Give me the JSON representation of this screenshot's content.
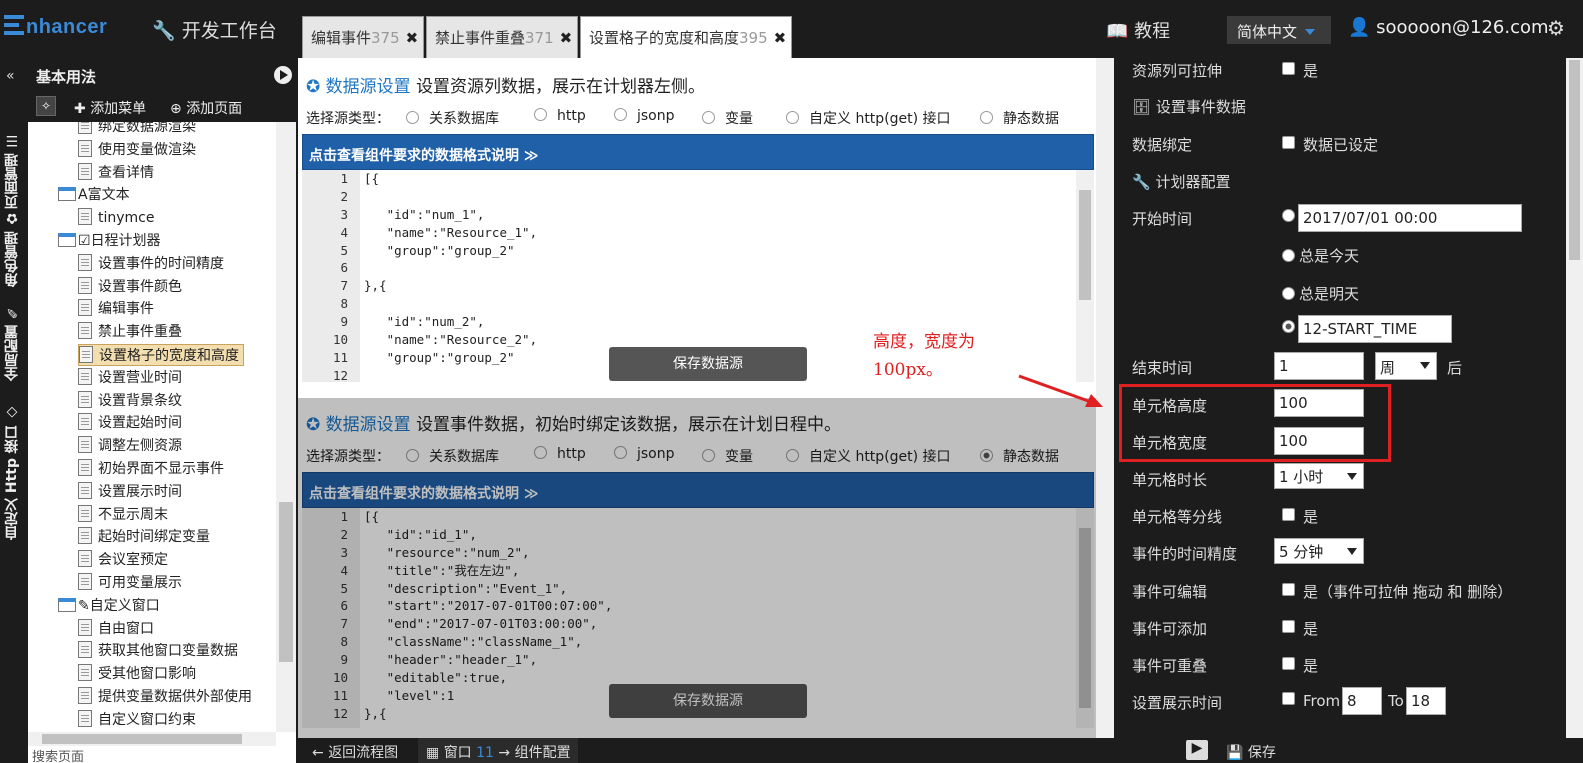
{
  "header": {
    "logo": "nhancer",
    "devbench": "开发工作台",
    "tabs": [
      {
        "label": "编辑事件",
        "count": "375"
      },
      {
        "label": "禁止事件重叠",
        "count": "371"
      },
      {
        "label": "设置格子的宽度和高度",
        "count": "395"
      }
    ],
    "tab_close": "✖",
    "tutorial": "教程",
    "language": "简体中文",
    "user": "sooooon@126.com"
  },
  "vtabs": [
    "页面管理",
    "角色管理",
    "全局配置",
    "自定义 Http 接口"
  ],
  "sidebar": {
    "title": "基本用法",
    "add_menu": "添加菜单",
    "add_page": "添加页面",
    "search": "搜索页面",
    "tree": [
      {
        "label": "绑定数据源渲染",
        "type": "doc",
        "level": 2
      },
      {
        "label": "使用变量做渲染",
        "type": "doc",
        "level": 2
      },
      {
        "label": "查看详情",
        "type": "doc",
        "level": 2
      },
      {
        "label": "富文本",
        "type": "folder",
        "level": 1,
        "prefix": "A"
      },
      {
        "label": "tinymce",
        "type": "doc",
        "level": 2
      },
      {
        "label": "日程计划器",
        "type": "folder",
        "level": 1,
        "prefix": "☑"
      },
      {
        "label": "设置事件的时间精度",
        "type": "doc",
        "level": 2
      },
      {
        "label": "设置事件颜色",
        "type": "doc",
        "level": 2
      },
      {
        "label": "编辑事件",
        "type": "doc",
        "level": 2
      },
      {
        "label": "禁止事件重叠",
        "type": "doc",
        "level": 2
      },
      {
        "label": "设置格子的宽度和高度",
        "type": "doc",
        "level": 2,
        "selected": true
      },
      {
        "label": "设置营业时间",
        "type": "doc",
        "level": 2
      },
      {
        "label": "设置背景条纹",
        "type": "doc",
        "level": 2
      },
      {
        "label": "设置起始时间",
        "type": "doc",
        "level": 2
      },
      {
        "label": "调整左侧资源",
        "type": "doc",
        "level": 2
      },
      {
        "label": "初始界面不显示事件",
        "type": "doc",
        "level": 2
      },
      {
        "label": "设置展示时间",
        "type": "doc",
        "level": 2
      },
      {
        "label": "不显示周末",
        "type": "doc",
        "level": 2
      },
      {
        "label": "起始时间绑定变量",
        "type": "doc",
        "level": 2
      },
      {
        "label": "会议室预定",
        "type": "doc",
        "level": 2
      },
      {
        "label": "可用变量展示",
        "type": "doc",
        "level": 2
      },
      {
        "label": "自定义窗口",
        "type": "folder",
        "level": 1,
        "prefix": "✎"
      },
      {
        "label": "自由窗口",
        "type": "doc",
        "level": 2
      },
      {
        "label": "获取其他窗口变量数据",
        "type": "doc",
        "level": 2
      },
      {
        "label": "受其他窗口影响",
        "type": "doc",
        "level": 2
      },
      {
        "label": "提供变量数据供外部使用",
        "type": "doc",
        "level": 2
      },
      {
        "label": "自定义窗口约束",
        "type": "doc",
        "level": 2
      }
    ]
  },
  "datasource1": {
    "title": "数据源设置",
    "desc": "设置资源列数据，展示在计划器左侧。",
    "source_label": "选择源类型：",
    "options": [
      "关系数据库",
      "http",
      "jsonp",
      "变量",
      "自定义 http(get) 接口",
      "静态数据"
    ],
    "selected": -1,
    "format_bar": "点击查看组件要求的数据格式说明 ≫",
    "line_numbers": [
      "1",
      "2",
      "3",
      "4",
      "5",
      "6",
      "7",
      "8",
      "9",
      "10",
      "11",
      "12"
    ],
    "code": [
      "[{",
      "",
      "   \"id\":\"num_1\",",
      "   \"name\":\"Resource_1\",",
      "   \"group\":\"group_2\"",
      "",
      "},{",
      "",
      "   \"id\":\"num_2\",",
      "   \"name\":\"Resource_2\",",
      "   \"group\":\"group_2\"",
      ""
    ],
    "save": "保存数据源"
  },
  "datasource2": {
    "title": "数据源设置",
    "desc": "设置事件数据，初始时绑定该数据，展示在计划日程中。",
    "source_label": "选择源类型：",
    "options": [
      "关系数据库",
      "http",
      "jsonp",
      "变量",
      "自定义 http(get) 接口",
      "静态数据"
    ],
    "selected": 5,
    "format_bar": "点击查看组件要求的数据格式说明 ≫",
    "line_numbers": [
      "1",
      "2",
      "3",
      "4",
      "5",
      "6",
      "7",
      "8",
      "9",
      "10",
      "11",
      "12"
    ],
    "code": [
      "[{",
      "   \"id\":\"id_1\",",
      "   \"resource\":\"num_2\",",
      "   \"title\":\"我在左边\",",
      "   \"description\":\"Event_1\",",
      "   \"start\":\"2017-07-01T00:07:00\",",
      "   \"end\":\"2017-07-01T03:00:00\",",
      "   \"className\":\"className_1\",",
      "   \"header\":\"header_1\",",
      "   \"editable\":true,",
      "   \"level\":1",
      "},{"
    ],
    "save": "保存数据源"
  },
  "annotation": {
    "line1": "高度，宽度为",
    "line2": "100px。"
  },
  "props": {
    "resizable_label": "资源列可拉伸",
    "yes": "是",
    "event_data_header": "设置事件数据",
    "data_binding_label": "数据绑定",
    "data_set": "数据已设定",
    "planner_config_header": "计划器配置",
    "start_time_label": "开始时间",
    "start_time_value": "2017/07/01  00:00",
    "always_today": "总是今天",
    "always_tomorrow": "总是明天",
    "start_var_value": "12-START_TIME",
    "end_time_label": "结束时间",
    "end_time_value": "1",
    "end_unit": "周",
    "after": "后",
    "cell_height_label": "单元格高度",
    "cell_height_value": "100",
    "cell_width_label": "单元格宽度",
    "cell_width_value": "100",
    "cell_duration_label": "单元格时长",
    "cell_duration_value": "1 小时",
    "cell_divider_label": "单元格等分线",
    "precision_label": "事件的时间精度",
    "precision_value": "5 分钟",
    "editable_label": "事件可编辑",
    "editable_text": "是（事件可拉伸 拖动 和 删除）",
    "addable_label": "事件可添加",
    "overlap_label": "事件可重叠",
    "display_time_label": "设置展示时间",
    "from": "From",
    "from_value": "8",
    "to": "To",
    "to_value": "18"
  },
  "bottom": {
    "back": "返回流程图",
    "window": "窗口",
    "window_num": "11",
    "component_config": "组件配置",
    "save": "保存"
  }
}
